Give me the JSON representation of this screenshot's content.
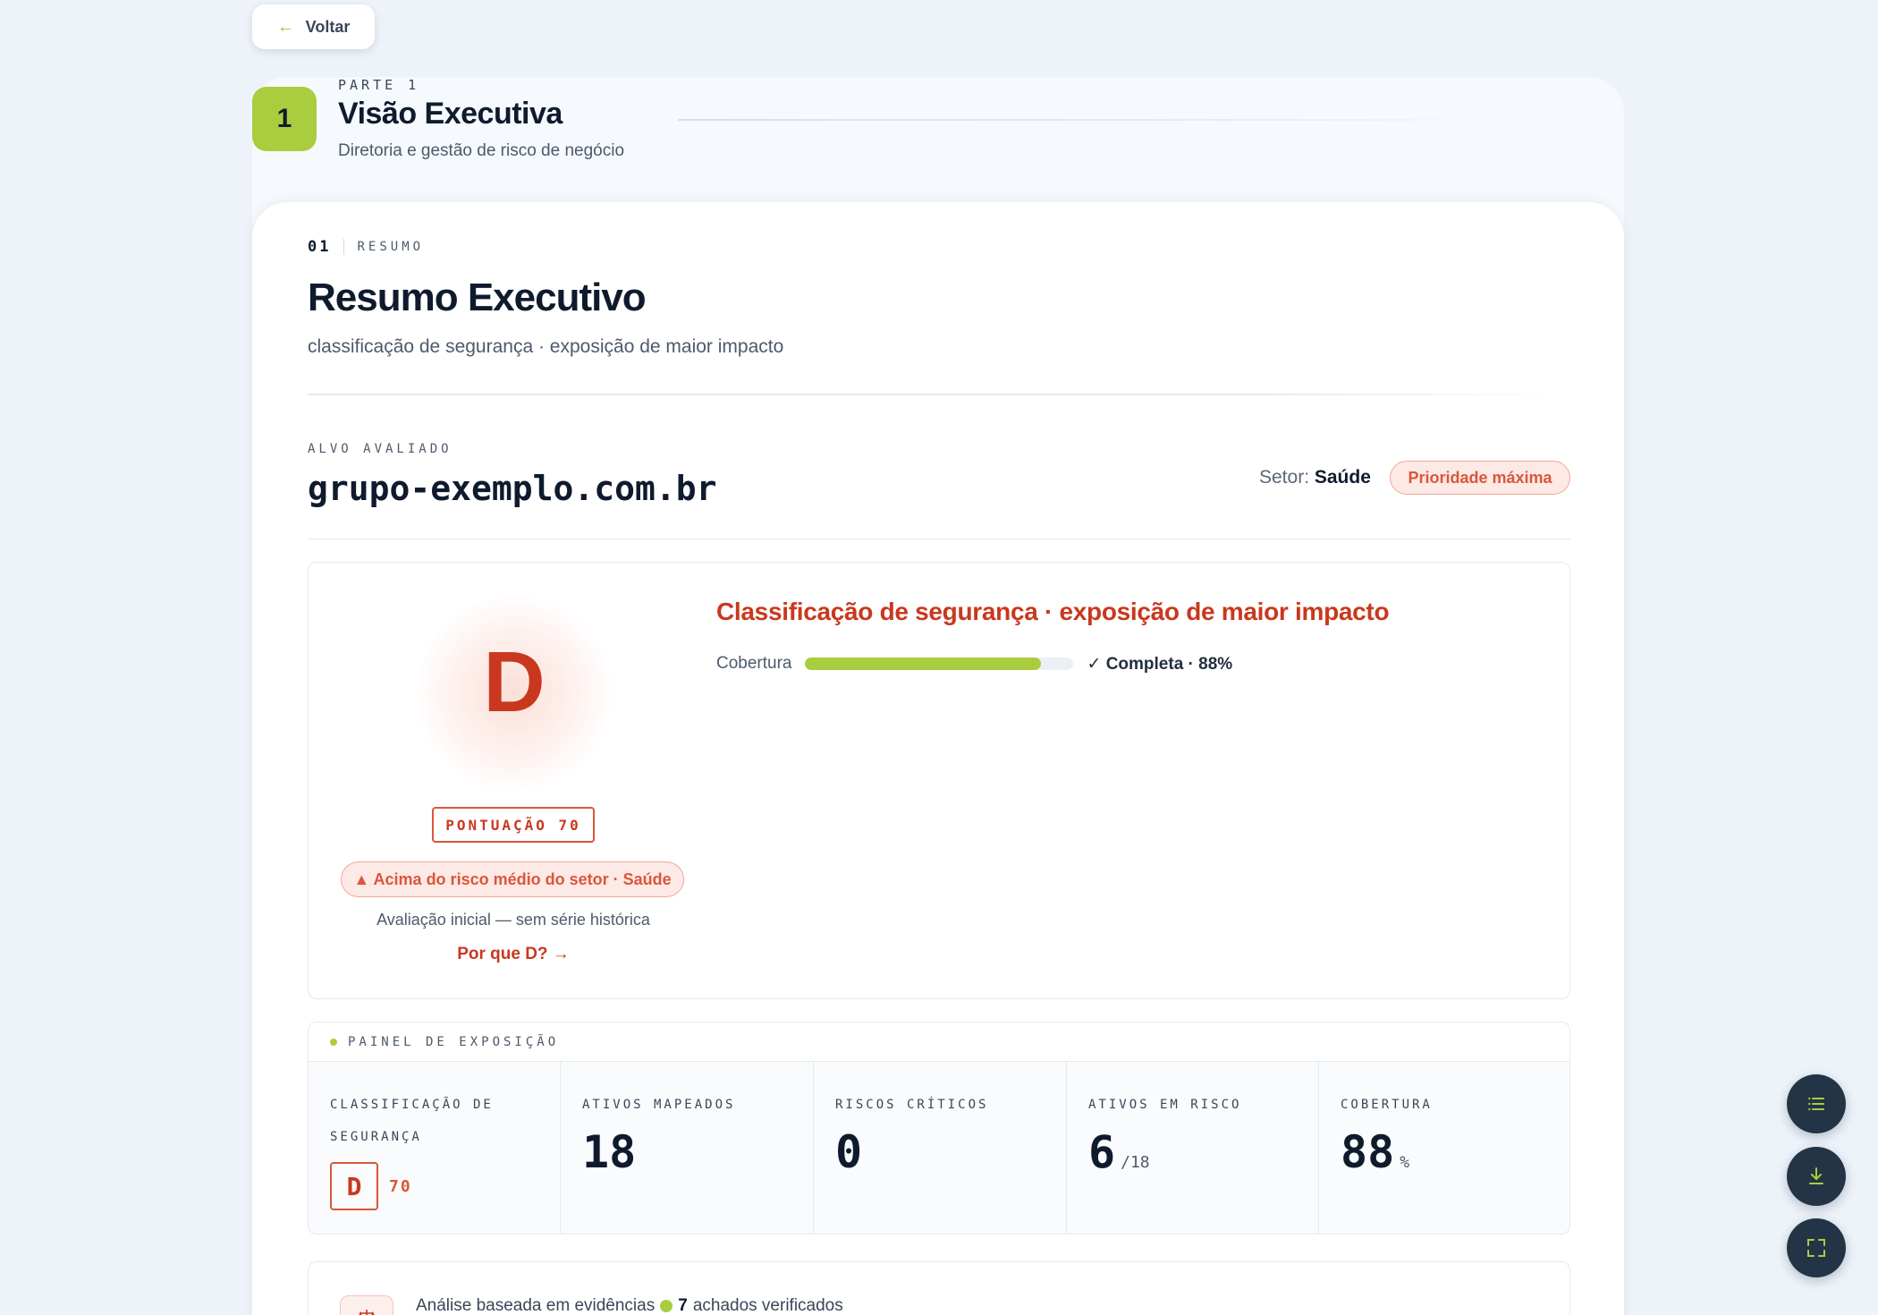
{
  "nav": {
    "back_label": "Voltar"
  },
  "part": {
    "number": "1",
    "kicker": "PARTE 1",
    "title": "Visão Executiva",
    "subtitle": "Diretoria e gestão de risco de negócio"
  },
  "section": {
    "number": "01",
    "label": "RESUMO",
    "title": "Resumo Executivo",
    "subtitle": "classificação de segurança · exposição de maior impacto"
  },
  "target": {
    "label": "ALVO AVALIADO",
    "domain": "grupo-exemplo.com.br",
    "sector_label": "Setor:",
    "sector_value": "Saúde",
    "priority": "Prioridade máxima"
  },
  "grade": {
    "letter": "D",
    "score_label": "PONTUAÇÃO 70",
    "risk_note": "▲ Acima do risco médio do setor · Saúde",
    "evaluation_note": "Avaliação inicial — sem série histórica",
    "why_link": "Por que D? →"
  },
  "classification": {
    "heading": "Classificação de segurança · exposição de maior impacto",
    "coverage_label": "Cobertura",
    "coverage_fraction": 0.88,
    "coverage_status": "✓ Completa · 88%"
  },
  "exposure": {
    "title": "PAINEL DE EXPOSIÇÃO",
    "kpis": [
      {
        "label": "CLASSIFICAÇÃO DE SEGURANÇA",
        "grade": "D",
        "score": "70"
      },
      {
        "label": "ATIVOS MAPEADOS",
        "value": "18",
        "suffix": ""
      },
      {
        "label": "RISCOS CRÍTICOS",
        "value": "0",
        "suffix": ""
      },
      {
        "label": "ATIVOS EM RISCO",
        "value": "6",
        "suffix": "/18"
      },
      {
        "label": "COBERTURA",
        "value": "88",
        "suffix": "%"
      }
    ]
  },
  "evidence": {
    "prefix": "Análise baseada em evidências",
    "count": "7",
    "suffix": "achados verificados"
  },
  "colors": {
    "accent": "#a9cd3e",
    "danger": "#c9381e",
    "dark": "#0f1b2d",
    "fab": "#243447"
  },
  "fabs": {
    "icons": [
      "list-icon",
      "download-icon",
      "fullscreen-icon"
    ]
  }
}
